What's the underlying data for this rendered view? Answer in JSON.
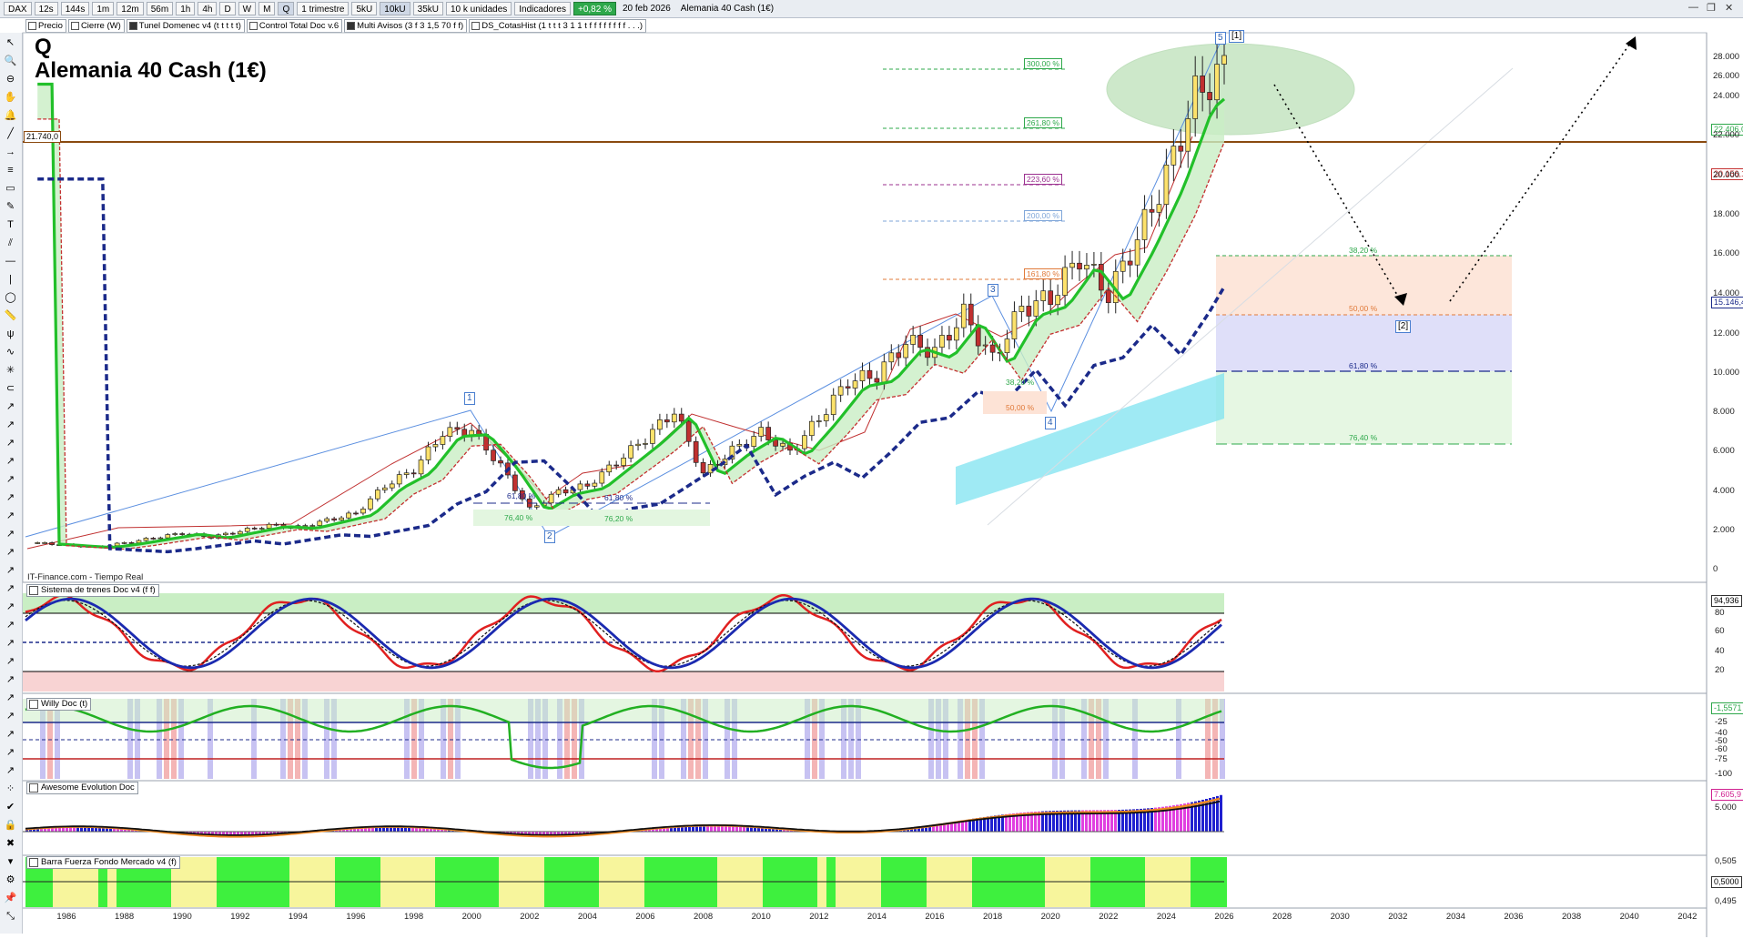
{
  "toolbar": {
    "symbol": "DAX",
    "intervals": [
      "12s",
      "144s",
      "1m",
      "12m",
      "56m",
      "1h",
      "4h",
      "D",
      "W",
      "M",
      "Q"
    ],
    "period": "1 trimestre",
    "units": [
      "5kU",
      "10kU",
      "35kU"
    ],
    "units_select": "10 k unidades",
    "indicators": "Indicadores",
    "change": "+0,82 %",
    "date": "20 feb 2026",
    "title": "Alemania 40 Cash (1€)"
  },
  "studies": [
    "Precio",
    "Cierre (W)",
    "Tunel Domenec v4 (t t t t t)",
    "Control Total Doc v.6",
    "Multi Avisos (3 f 3 1,5 70 f f)",
    "DS_CotasHist (1 t t t 3 1 1 t f f f f f f f f . . .)"
  ],
  "chart": {
    "symbol_letter": "Q",
    "name": "Alemania 40 Cash (1€)",
    "source": "IT-Finance.com - Tiempo Real",
    "left_price_tag": "21.740,0",
    "right_price_tags": [
      "22.406,0",
      "20.156,1",
      "15.146,4"
    ],
    "yaxis": [
      "28.000",
      "26.000",
      "24.000",
      "22.000",
      "20.000",
      "18.000",
      "16.000",
      "14.000",
      "12.000",
      "10.000",
      "8.000",
      "6.000",
      "4.000",
      "2.000",
      "0"
    ],
    "fib_ext": [
      "300,00 %",
      "261,80 %",
      "223,60 %",
      "200,00 %",
      "161,80 %"
    ],
    "fib_ret": [
      "38,20 %",
      "50,00 %",
      "61,80 %",
      "76,40 %"
    ],
    "small_fib": [
      "61,80 %",
      "76,40 %",
      "61,80 %",
      "76,20 %",
      "38,20 %",
      "50,00 %"
    ],
    "waves": [
      "1",
      "2",
      "3",
      "4",
      "5",
      "[1]",
      "[2]"
    ]
  },
  "panels": {
    "trenes": {
      "title": "Sistema de trenes Doc v4 (f f)",
      "axis": [
        "94,936",
        "80",
        "60",
        "40",
        "20"
      ]
    },
    "willy": {
      "title": "Willy Doc (t)",
      "axis": [
        "-1,5571",
        "-25",
        "-40",
        "-50",
        "-60",
        "-75",
        "-100"
      ]
    },
    "awesome": {
      "title": "Awesome Evolution Doc",
      "axis": [
        "7.605,9",
        "5.000"
      ]
    },
    "barra": {
      "title": "Barra Fuerza Fondo Mercado v4 (f)",
      "axis": [
        "0,505",
        "0,5000",
        "0,495"
      ]
    }
  },
  "years": [
    "1986",
    "1988",
    "1990",
    "1992",
    "1994",
    "1996",
    "1998",
    "2000",
    "2002",
    "2004",
    "2006",
    "2008",
    "2010",
    "2012",
    "2014",
    "2016",
    "2018",
    "2020",
    "2022",
    "2024",
    "2026",
    "2028",
    "2030",
    "2032",
    "2034",
    "2036",
    "2038",
    "2040",
    "2042"
  ],
  "colors": {
    "accent": "#2ea84b",
    "ma_green": "#22c02a",
    "ma_navy": "#1b2a8a",
    "cloud": "#7fe3f0",
    "barra_green": "#3ef03e",
    "barra_yellow": "#f7f59c"
  }
}
